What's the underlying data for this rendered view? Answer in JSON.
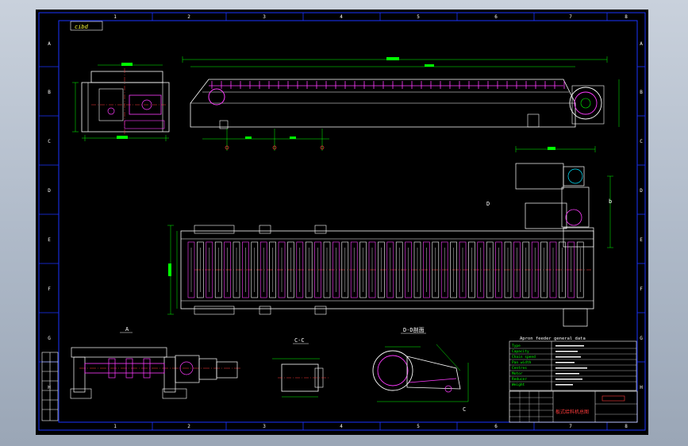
{
  "drawing": {
    "corner_tag": "cibd",
    "top_col_markers": [
      "1",
      "2",
      "3",
      "4",
      "5",
      "6",
      "7",
      "8"
    ],
    "bottom_col_markers": [
      "1",
      "2",
      "3",
      "4",
      "5",
      "6",
      "7",
      "8"
    ],
    "left_row_markers": [
      "A",
      "B",
      "C",
      "D",
      "E",
      "F",
      "G",
      "H"
    ],
    "right_row_markers": [
      "A",
      "B",
      "C",
      "D",
      "E",
      "F",
      "G",
      "H"
    ],
    "section_c_label": "C-C",
    "section_d_label": "D-D剖面",
    "view_a_label": "A",
    "view_d_marker": "D",
    "view_b_marker": "b",
    "section_c_marker": "C",
    "spec_table_title": "Apron feeder general data",
    "spec_rows": [
      "Type",
      "Capacity",
      "Chain speed",
      "Pan width",
      "Centres",
      "Motor",
      "Reducer",
      "Weight"
    ],
    "title_block_name": "板式给料机总图",
    "colors": {
      "frame": "#1a33ff",
      "linework": "#ffffff",
      "dimensions": "#00ff00",
      "machine_parts": "#ff3bff",
      "centerlines": "#ff3b3b",
      "text_yellow": "#ffff3b",
      "cyan": "#00e5ff"
    }
  }
}
